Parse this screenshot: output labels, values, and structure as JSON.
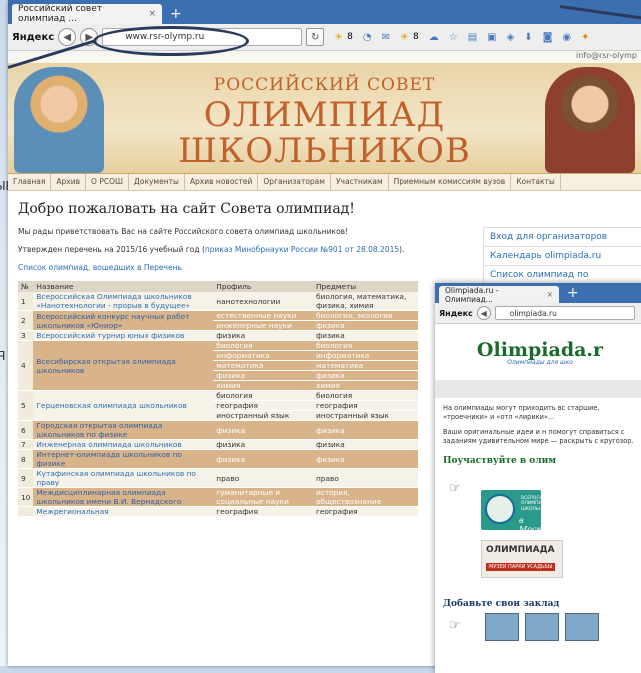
{
  "slide_fragments": [
    "ЫЕ",
    "Я"
  ],
  "win1": {
    "tab_title": "Российский совет олимпиад ...",
    "tab_close": "×",
    "new_tab": "+",
    "browser_brand": "Яндекс",
    "url": "www.rsr-olymp.ru",
    "weather_items": [
      "8",
      "8"
    ],
    "email": "info@rsr-olymp",
    "banner": {
      "line1": "РОССИЙСКИЙ СОВЕТ",
      "line2": "ОЛИМПИАД",
      "line3": "ШКОЛЬНИКОВ"
    },
    "menu": [
      "Главная",
      "Архив",
      "О РСОШ",
      "Документы",
      "Архив новостей",
      "Организаторам",
      "Участникам",
      "Приемным комиссиям вузов",
      "Контакты"
    ],
    "heading": "Добро пожаловать на сайт Совета олимпиад!",
    "intro": "Мы рады приветствовать Вас на сайте Российского совета олимпиад школьников!",
    "approved_prefix": "Утвержден перечень на 2015/16 учебный год (",
    "approved_link": "приказ Минобрнауки России №901 от 28.08.2015",
    "approved_suffix": ").",
    "list_link": "Список олимпиад, вошедших в Перечень",
    "sidebar": [
      "Вход для организаторов",
      "Календарь olimpiada.ru",
      "Список олимпиад по"
    ],
    "table": {
      "headers": [
        "№",
        "Название",
        "Профиль",
        "Предметы"
      ],
      "rows": [
        {
          "n": "1",
          "name": "Всероссийская Олимпиада школьников «Нанотехнологии - прорыв в будущее»",
          "profiles": [
            "нанотехнологии"
          ],
          "subjects": [
            "биология, математика, физика, химия"
          ],
          "hl": false
        },
        {
          "n": "2",
          "name": "Всероссийский конкурс научных работ школьников «Юниор»",
          "profiles": [
            "естественные науки",
            "инженерные науки"
          ],
          "subjects": [
            "биология, экология",
            "физика"
          ],
          "hl": true
        },
        {
          "n": "3",
          "name": "Всероссийский турнир юных физиков",
          "profiles": [
            "физика"
          ],
          "subjects": [
            "физика"
          ],
          "hl": false
        },
        {
          "n": "4",
          "name": "Всесибирская открытая олимпиада школьников",
          "profiles": [
            "биология",
            "информатика",
            "математика",
            "физика",
            "химия"
          ],
          "subjects": [
            "биология",
            "информатика",
            "математика",
            "физика",
            "химия"
          ],
          "hl": true
        },
        {
          "n": "5",
          "name": "Герценовская олимпиада школьников",
          "profiles": [
            "биология",
            "география",
            "иностранный язык"
          ],
          "subjects": [
            "биология",
            "география",
            "иностранный язык"
          ],
          "hl": false
        },
        {
          "n": "6",
          "name": "Городская открытая олимпиада школьников по физике",
          "profiles": [
            "физика"
          ],
          "subjects": [
            "физика"
          ],
          "hl": true
        },
        {
          "n": "7",
          "name": "Инженерная олимпиада школьников",
          "profiles": [
            "физика"
          ],
          "subjects": [
            "физика"
          ],
          "hl": false
        },
        {
          "n": "8",
          "name": "Интернет-олимпиада школьников по физике",
          "profiles": [
            "физика"
          ],
          "subjects": [
            "физика"
          ],
          "hl": true
        },
        {
          "n": "9",
          "name": "Кутафинская олимпиада школьников по праву",
          "profiles": [
            "право"
          ],
          "subjects": [
            "право"
          ],
          "hl": false
        },
        {
          "n": "10",
          "name": "Междисциплинарная олимпиада школьников имени В.И. Вернадского",
          "profiles": [
            "гуманитарные и социальные науки"
          ],
          "subjects": [
            "история, обществознание"
          ],
          "hl": true
        },
        {
          "n": "",
          "name": "Межрегиональная",
          "profiles": [
            "география"
          ],
          "subjects": [
            "география"
          ],
          "hl": false
        }
      ]
    }
  },
  "win2": {
    "tab_title": "Olimpiada.ru - Олимпиад...",
    "tab_close": "×",
    "new_tab": "+",
    "browser_brand": "Яндекс",
    "url": "olimpiada.ru",
    "logo": "Olimpiada.r",
    "logo_sub": "Олимпиады для шко",
    "text1": "На олимпиады могут приходить вс старшие, «троечники» и «отл «лирики»...",
    "text2": "Ваши оригинальные идеи и н помогут справиться с заданиям удивительном мире — раскрыть с кругозор.",
    "participate": "Поучаствуйте в олим",
    "badge1_text": "ВСЕРОССИЙСКАЯ ОЛИМПИАДА ШКОЛЬНИКОВ",
    "badge1_city": "в Москве",
    "badge2_title": "ОЛИМПИАДА",
    "badge2_sub": "МУЗЕИ ПАРКИ УСАДЬБЫ",
    "bookmarks": "Добавьте свои заклад"
  }
}
